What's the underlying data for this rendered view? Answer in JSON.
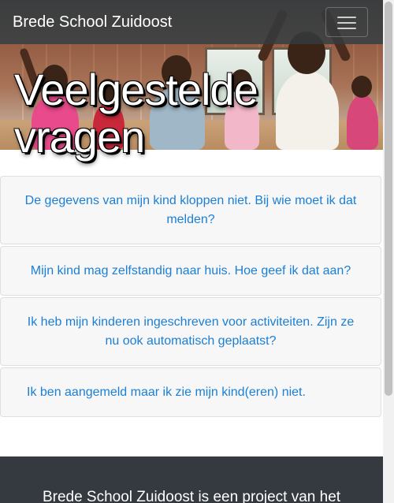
{
  "navbar": {
    "brand": "Brede School Zuidoost",
    "menu_icon": "hamburger-menu-icon"
  },
  "hero": {
    "title": "Veelgestelde vragen"
  },
  "faq": {
    "items": [
      {
        "question": "De gegevens van mijn kind kloppen niet. Bij wie moet ik dat melden?"
      },
      {
        "question": "Mijn kind mag zelfstandig naar huis. Hoe geef ik dat aan?"
      },
      {
        "question": "Ik heb mijn kinderen ingeschreven voor activiteiten. Zijn ze nu ook automatisch geplaatst?"
      },
      {
        "question": "Ik ben aangemeld maar ik zie mijn kind(eren) niet."
      }
    ]
  },
  "footer": {
    "text": "Brede School Zuidoost is een project van het"
  },
  "colors": {
    "navbar_bg": "#343a40",
    "link": "#1a7fd6",
    "card_bg": "#f7f7f7"
  }
}
